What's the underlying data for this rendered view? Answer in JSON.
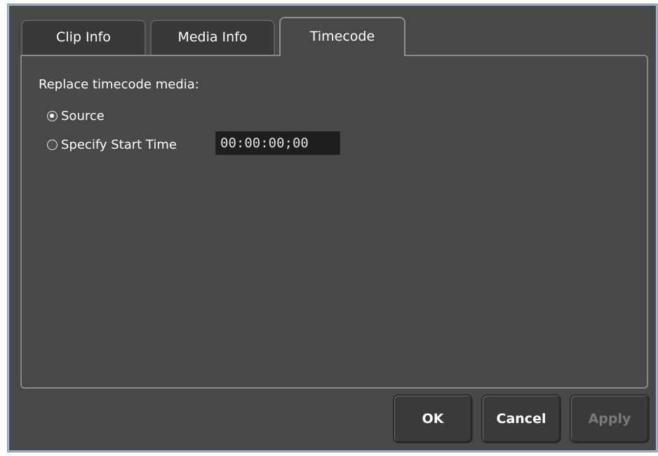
{
  "tabs": [
    {
      "label": "Clip Info",
      "active": false
    },
    {
      "label": "Media Info",
      "active": false
    },
    {
      "label": "Timecode",
      "active": true
    }
  ],
  "timecode": {
    "heading": "Replace timecode media:",
    "options": [
      {
        "label": "Source",
        "selected": true
      },
      {
        "label": "Specify Start Time",
        "selected": false
      }
    ],
    "start_time_value": "00:00:00;00"
  },
  "buttons": {
    "ok": "OK",
    "cancel": "Cancel",
    "apply": "Apply"
  },
  "colors": {
    "background": "#484848",
    "frame_border": "#8ea3c6",
    "input_background": "#1e1e1e",
    "disabled_text": "#7a7a7a"
  }
}
